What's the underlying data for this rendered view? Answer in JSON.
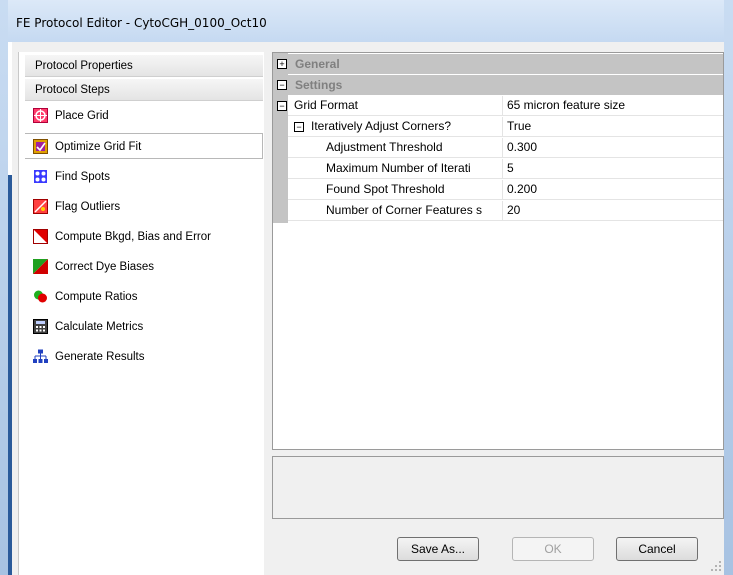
{
  "window": {
    "title": "FE Protocol Editor - CytoCGH_0100_Oct10"
  },
  "sidebar": {
    "headers": [
      {
        "label": "Protocol Properties"
      },
      {
        "label": "Protocol Steps"
      }
    ],
    "steps": [
      {
        "label": "Place Grid",
        "icon": "place-grid-icon"
      },
      {
        "label": "Optimize Grid Fit",
        "icon": "optimize-grid-icon",
        "selected": true
      },
      {
        "label": "Find Spots",
        "icon": "find-spots-icon"
      },
      {
        "label": "Flag Outliers",
        "icon": "flag-outliers-icon"
      },
      {
        "label": "Compute Bkgd, Bias and Error",
        "icon": "compute-bkgd-icon"
      },
      {
        "label": "Correct Dye Biases",
        "icon": "correct-dye-icon"
      },
      {
        "label": "Compute Ratios",
        "icon": "compute-ratios-icon"
      },
      {
        "label": "Calculate Metrics",
        "icon": "calculate-metrics-icon"
      },
      {
        "label": "Generate Results",
        "icon": "generate-results-icon"
      }
    ]
  },
  "grid": {
    "categories": [
      {
        "label": "General",
        "expander": "+"
      },
      {
        "label": "Settings",
        "expander": "−"
      }
    ],
    "rows": [
      {
        "name": "Grid Format",
        "value": "65 micron feature size",
        "expander": "−"
      },
      {
        "name": "Iteratively Adjust Corners?",
        "value": "True",
        "expander": "−"
      },
      {
        "name": "Adjustment Threshold",
        "value": "0.300"
      },
      {
        "name": "Maximum Number of Iterati",
        "value": "5"
      },
      {
        "name": "Found Spot Threshold",
        "value": "0.200"
      },
      {
        "name": "Number of Corner Features s",
        "value": "20"
      }
    ]
  },
  "buttons": {
    "save_as": "Save As...",
    "ok": "OK",
    "cancel": "Cancel"
  },
  "colors": {
    "category_bg": "#c4c4c4",
    "category_text": "#808080",
    "window_frame": "#c5d9f1"
  }
}
